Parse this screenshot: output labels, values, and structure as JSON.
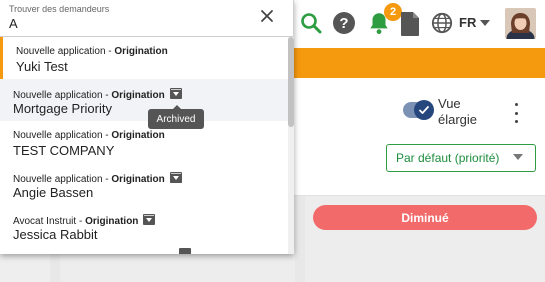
{
  "search": {
    "label": "Trouver des demandeurs",
    "value": "A"
  },
  "results": [
    {
      "type": "Nouvelle application",
      "sep": " - ",
      "stage": "Origination",
      "name": "Yuki Test",
      "archived": false
    },
    {
      "type": "Nouvelle application",
      "sep": " - ",
      "stage": "Origination",
      "name": "Mortgage Priority",
      "archived": true
    },
    {
      "type": "Nouvelle application",
      "sep": " - ",
      "stage": "Origination",
      "name": "TEST COMPANY",
      "archived": false
    },
    {
      "type": "Nouvelle application",
      "sep": " - ",
      "stage": "Origination",
      "name": "Angie Bassen",
      "archived": true
    },
    {
      "type": "Avocat Instruit",
      "sep": " - ",
      "stage": "Origination",
      "name": "Jessica Rabbit",
      "archived": true
    }
  ],
  "tooltip": "Archived",
  "header": {
    "notification_count": "2",
    "language": "FR"
  },
  "view_toggle": {
    "label": "Vue élargie"
  },
  "sort_select": {
    "value": "Par défaut (priorité)"
  },
  "status_pill": {
    "label": "Diminué"
  },
  "colors": {
    "accent": "#f5990f",
    "green": "#2e9c41",
    "navy": "#26467e",
    "danger": "#f36a6a"
  }
}
